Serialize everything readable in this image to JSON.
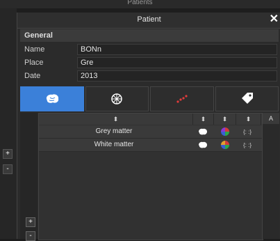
{
  "background": {
    "title": "Patients",
    "left_buttons": [
      {
        "label": "+"
      },
      {
        "label": "-"
      }
    ]
  },
  "dialog": {
    "title": "Patient",
    "close_label": "✕",
    "section": "General",
    "fields": [
      {
        "label": "Name",
        "value": "BONn"
      },
      {
        "label": "Place",
        "value": "Gre"
      },
      {
        "label": "Date",
        "value": "2013"
      }
    ],
    "tabs": [
      {
        "icon": "brain-icon",
        "active": true
      },
      {
        "icon": "brain-mesh-icon",
        "active": false
      },
      {
        "icon": "sites-icon",
        "active": false
      },
      {
        "icon": "tag-icon",
        "active": false
      }
    ],
    "table": {
      "sort_glyph": "⬍",
      "extra_column": "A",
      "rows": [
        {
          "name": "Grey matter",
          "code": "{: :}"
        },
        {
          "name": "White matter",
          "code": "{: :}"
        }
      ]
    },
    "left_buttons": [
      {
        "label": "+"
      },
      {
        "label": "-"
      }
    ]
  }
}
